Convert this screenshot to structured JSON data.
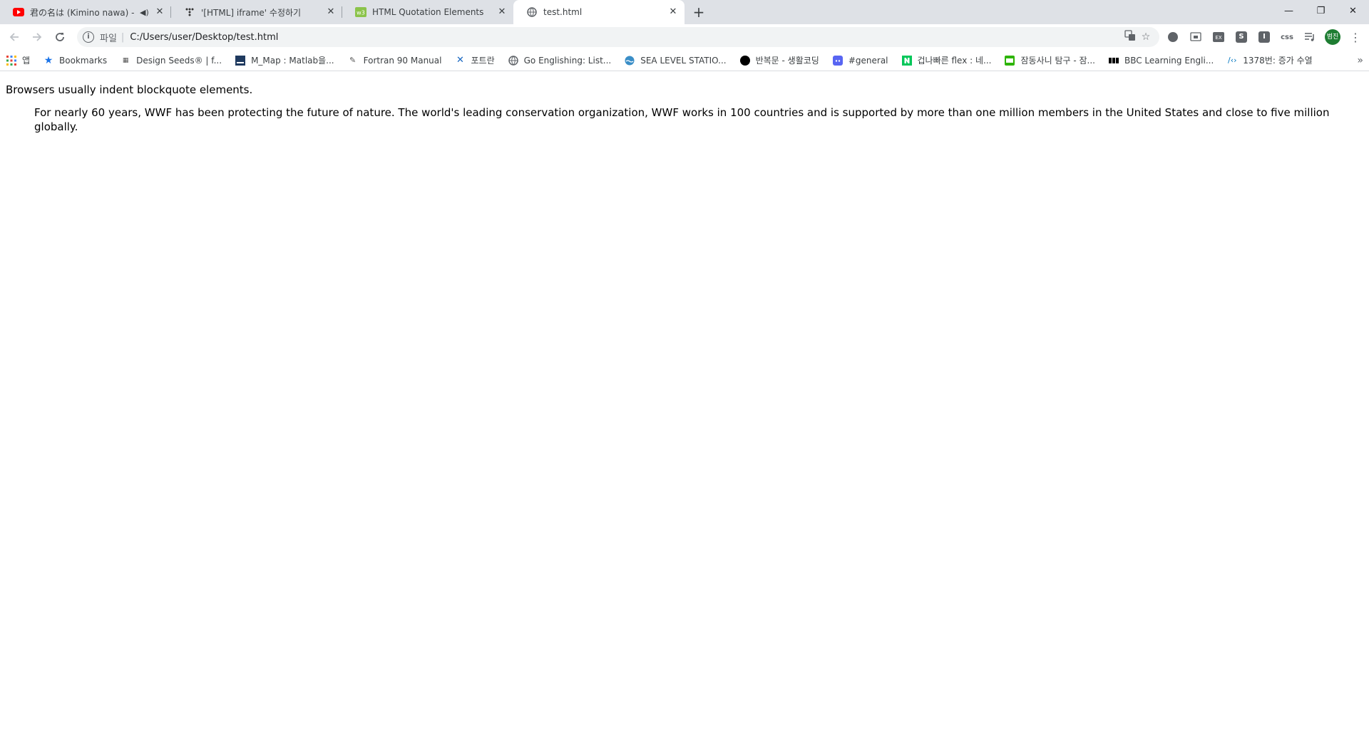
{
  "tabs": [
    {
      "title": "君の名は (Kimino nawa) - ",
      "icon": "youtube-icon",
      "audio": true,
      "active": false
    },
    {
      "title": "'[HTML] iframe' 수정하기",
      "icon": "velog-icon",
      "audio": false,
      "active": false
    },
    {
      "title": "HTML Quotation Elements",
      "icon": "w3schools-icon",
      "audio": false,
      "active": false
    },
    {
      "title": "test.html",
      "icon": "globe-icon",
      "audio": false,
      "active": true
    }
  ],
  "omnibox": {
    "scheme": "파일",
    "url": "C:/Users/user/Desktop/test.html"
  },
  "extensions": [
    "S",
    "I",
    "css"
  ],
  "avatar_label": "범진",
  "bookmarks": [
    {
      "label": "앱",
      "icon": "apps-grid-icon"
    },
    {
      "label": "Bookmarks",
      "icon": "star-icon"
    },
    {
      "label": "Design Seeds® | f...",
      "icon": "design-seeds-icon"
    },
    {
      "label": "M_Map : Matlab을...",
      "icon": "mmap-icon"
    },
    {
      "label": "Fortran 90 Manual",
      "icon": "fortran-icon"
    },
    {
      "label": "포트란",
      "icon": "fortran-tools-icon"
    },
    {
      "label": "Go Englishing: List...",
      "icon": "globe-icon"
    },
    {
      "label": "SEA LEVEL STATIO...",
      "icon": "sea-level-icon"
    },
    {
      "label": "반복문 - 생활코딩",
      "icon": "black-circle-icon"
    },
    {
      "label": "#general",
      "icon": "discord-icon"
    },
    {
      "label": "겁나빠른 flex : 네...",
      "icon": "naver-icon"
    },
    {
      "label": "잠동사니 탐구 - 잠...",
      "icon": "blog-icon"
    },
    {
      "label": "BBC Learning Engli...",
      "icon": "bbc-icon"
    },
    {
      "label": "1378번: 증가 수열",
      "icon": "code-icon"
    }
  ],
  "content": {
    "intro": "Browsers usually indent blockquote elements.",
    "quote": "For nearly 60 years, WWF has been protecting the future of nature. The world's leading conservation organization, WWF works in 100 countries and is supported by more than one million members in the United States and close to five million globally."
  }
}
